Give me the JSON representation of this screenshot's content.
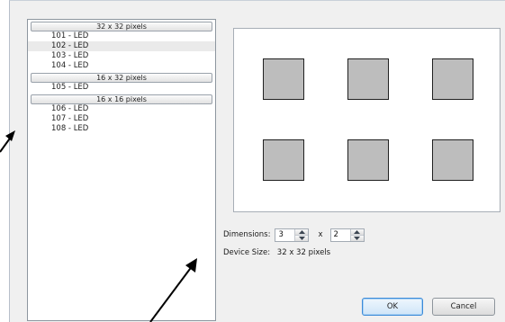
{
  "device_list": {
    "groups": [
      {
        "header": "32 x 32 pixels",
        "items": [
          "101 - LED",
          "102 - LED",
          "103 - LED",
          "104 - LED"
        ]
      },
      {
        "header": "16 x 32 pixels",
        "items": [
          "105 - LED"
        ]
      },
      {
        "header": "16 x 16 pixels",
        "items": [
          "106 - LED",
          "107 - LED",
          "108 - LED"
        ]
      }
    ],
    "selected_item": "102 - LED"
  },
  "preview": {
    "columns": 3,
    "rows": 2
  },
  "dimensions": {
    "label": "Dimensions:",
    "width": "3",
    "separator": "x",
    "height": "2"
  },
  "device_size": {
    "label": "Device Size:",
    "value": "32 x 32 pixels"
  },
  "buttons": {
    "ok": "OK",
    "cancel": "Cancel"
  },
  "colors": {
    "cell_fill": "#bdbdbd",
    "ok_border": "#3b8ad8",
    "selected_row": "#eaeaea"
  },
  "icons": {
    "spin_up": "triangle-up-icon",
    "spin_down": "triangle-down-icon"
  }
}
